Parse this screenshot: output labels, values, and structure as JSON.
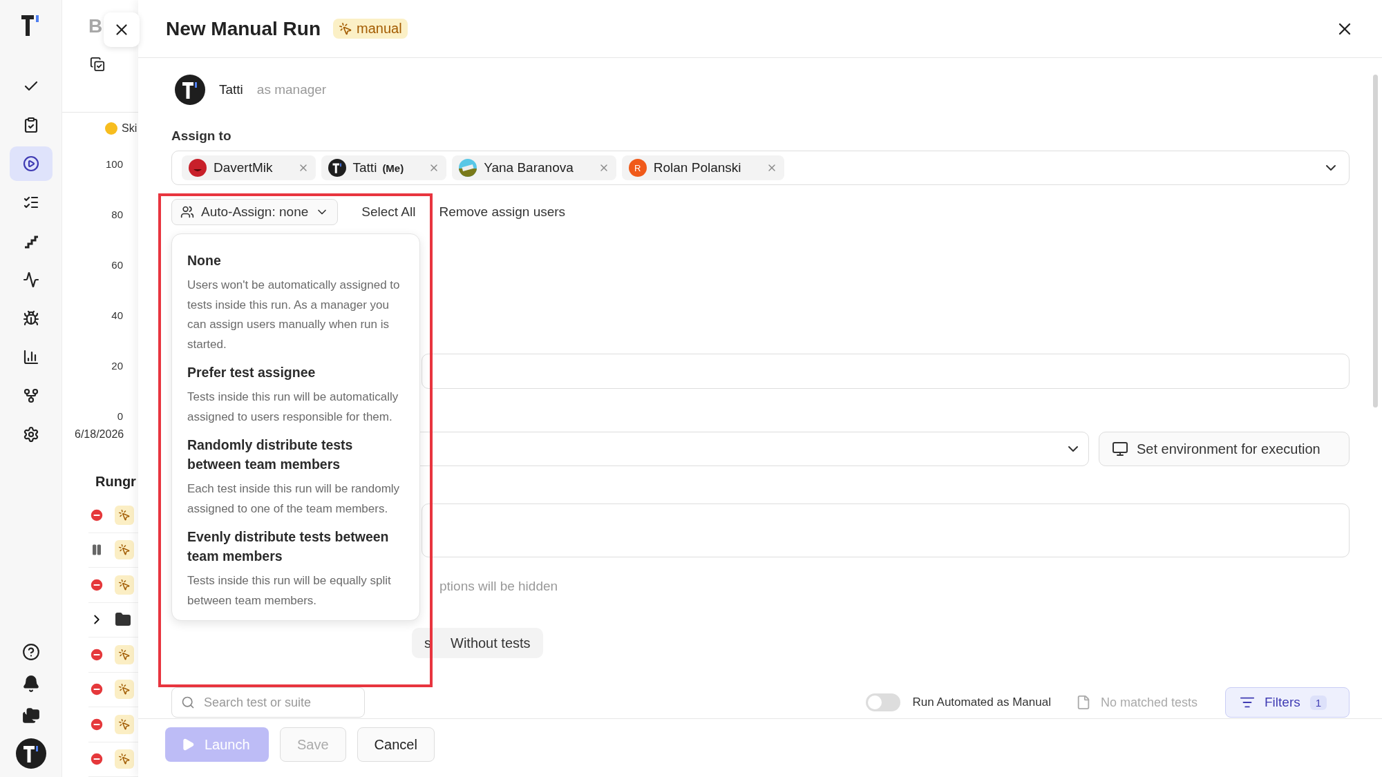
{
  "sidebar": {
    "nav_items": [
      {
        "selected": false
      },
      {
        "selected": false
      },
      {
        "selected": true
      },
      {
        "selected": false
      },
      {
        "selected": false
      },
      {
        "selected": false
      },
      {
        "selected": false
      },
      {
        "selected": false
      },
      {
        "selected": false
      },
      {
        "selected": false
      }
    ]
  },
  "background": {
    "title_initial": "B",
    "legend": "Ski",
    "y_ticks": [
      "100",
      "80",
      "60",
      "40",
      "20",
      "0"
    ],
    "date": "6/18/2026",
    "section_title": "Rungr",
    "rows": [
      {
        "kind": "failed"
      },
      {
        "kind": "paused"
      },
      {
        "kind": "failed"
      },
      {
        "kind": "folder"
      },
      {
        "kind": "failed"
      },
      {
        "kind": "failed"
      },
      {
        "kind": "failed"
      },
      {
        "kind": "failed"
      }
    ]
  },
  "drawer": {
    "title": "New Manual Run",
    "badge": "manual",
    "manager": {
      "name": "Tatti",
      "role": "as manager"
    },
    "assign_label": "Assign to",
    "assignees": [
      {
        "name": "DavertMik",
        "kind": "red"
      },
      {
        "name": "Tatti",
        "tag": "(Me)",
        "kind": "logo"
      },
      {
        "name": "Yana Baranova",
        "kind": "picture"
      },
      {
        "name": "Rolan Polanski",
        "kind": "initial",
        "initial": "R"
      }
    ],
    "auto_assign": "Auto-Assign: none",
    "select_all": "Select All",
    "remove_assign": "Remove assign users",
    "options": [
      {
        "title": "None",
        "description": "Users won't be automatically assigned to tests inside this run. As a manager you can assign users manually when run is started."
      },
      {
        "title": "Prefer test assignee",
        "description": "Tests inside this run will be automatically assigned to users responsible for them."
      },
      {
        "title": "Randomly distribute tests between team members",
        "description": "Each test inside this run will be randomly assigned to one of the team members."
      },
      {
        "title": "Evenly distribute tests between team members",
        "description": "Tests inside this run will be equally split between team members."
      }
    ],
    "environment_button": "Set environment for execution",
    "hint": "ptions will be hidden",
    "segments": [
      {
        "label": "s",
        "selected": false
      },
      {
        "label": "Without tests",
        "selected": false
      }
    ],
    "search": {
      "placeholder": "Search test or suite"
    },
    "toggle": {
      "label": "Run Automated as Manual",
      "on": false
    },
    "matched": "No matched tests",
    "filters": {
      "label": "Filters",
      "count": "1"
    },
    "footer_buttons": [
      {
        "label": "Launch",
        "kind": "primary",
        "disabled": true
      },
      {
        "label": "Save",
        "kind": "default",
        "disabled": true
      },
      {
        "label": "Cancel",
        "kind": "default",
        "disabled": false
      }
    ]
  }
}
